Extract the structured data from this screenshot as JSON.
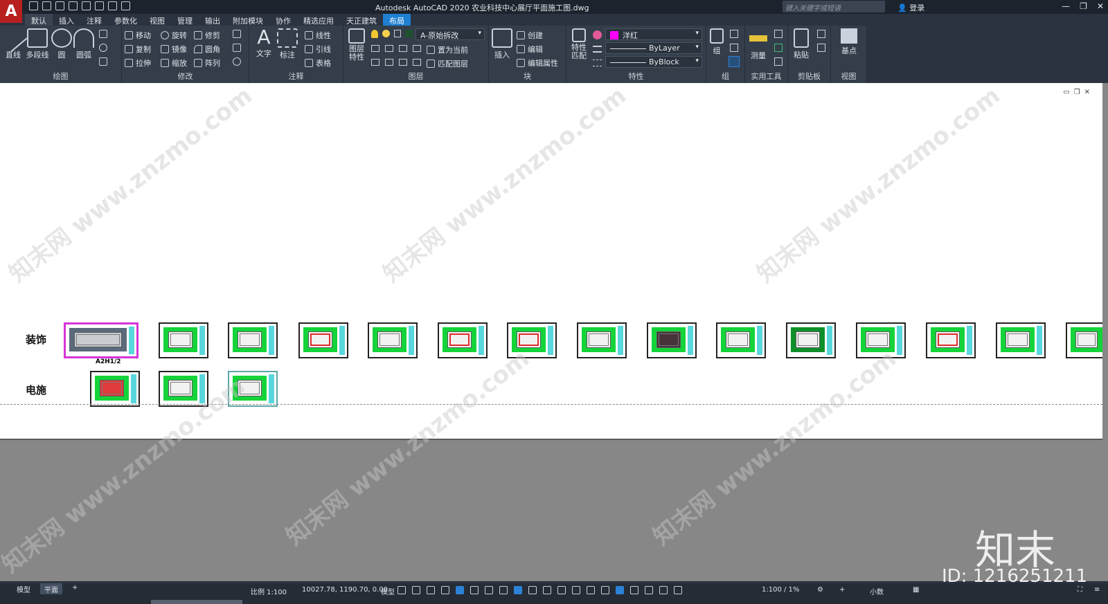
{
  "title_bar": {
    "logo": "A",
    "title": "Autodesk AutoCAD 2020    农业科技中心展厅平面施工图.dwg",
    "search_placeholder": "键入关键字或短语",
    "login": "登录"
  },
  "tabs": [
    "默认",
    "插入",
    "注释",
    "参数化",
    "视图",
    "管理",
    "输出",
    "附加模块",
    "协作",
    "精选应用",
    "天正建筑",
    "布局"
  ],
  "ribbon": {
    "draw": {
      "label": "绘图",
      "tools": [
        "直线",
        "多段线",
        "圆",
        "圆弧"
      ]
    },
    "modify": {
      "label": "修改",
      "tools": [
        "移动",
        "旋转",
        "修剪",
        "复制",
        "镜像",
        "圆角",
        "拉伸",
        "缩放",
        "阵列"
      ]
    },
    "annotation": {
      "label": "注释",
      "tools": [
        "文字",
        "标注",
        "线性",
        "引线",
        "表格"
      ]
    },
    "layers": {
      "label": "图层",
      "layer_name": "A-原始拆改",
      "tools": [
        "图层特性",
        "置为当前",
        "匹配图层"
      ]
    },
    "block": {
      "label": "块",
      "tools": [
        "插入",
        "创建",
        "编辑",
        "编辑属性"
      ]
    },
    "properties": {
      "label": "特性",
      "color_name": "洋红",
      "color_hex": "#ff00ff",
      "linetype": "ByLayer",
      "lineweight": "ByBlock",
      "tools": [
        "特性匹配"
      ]
    },
    "group": {
      "label": "组",
      "tools": [
        "组"
      ]
    },
    "utilities": {
      "label": "实用工具",
      "tools": [
        "测量"
      ]
    },
    "clipboard": {
      "label": "剪贴板",
      "tools": [
        "粘贴"
      ]
    },
    "view": {
      "label": "视图",
      "tools": [
        "基点"
      ]
    }
  },
  "canvas": {
    "row1_label": "装饰",
    "row2_label": "电施",
    "selected_sheet_label": "A2H1/2"
  },
  "watermark": "知末网 www.znzmo.com",
  "brand": {
    "name": "知末",
    "id": "ID: 1216251211"
  },
  "layout_tabs": [
    "模型",
    "平面",
    "+"
  ],
  "status": {
    "scale": "比例 1:100",
    "coords": "10027.78, 1190.70, 0.00",
    "space": "模型",
    "anno_scale": "1:100 / 1%",
    "units": "小数"
  },
  "colors": {
    "accent": "#1f7fd1",
    "selection": "#d633d9",
    "plan_green": "#14d43a"
  }
}
